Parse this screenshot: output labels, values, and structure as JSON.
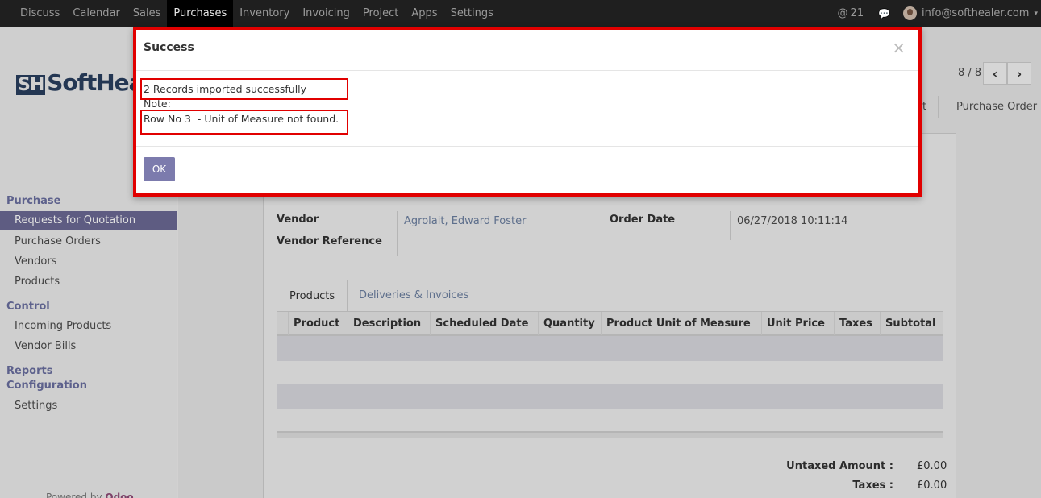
{
  "topbar": {
    "menu": [
      "Discuss",
      "Calendar",
      "Sales",
      "Purchases",
      "Inventory",
      "Invoicing",
      "Project",
      "Apps",
      "Settings"
    ],
    "active": "Purchases",
    "mentions": "21",
    "user": "info@softhealer.com"
  },
  "logo": {
    "mark": "SH",
    "text": "SoftHea"
  },
  "sidebar": {
    "purchase_title": "Purchase",
    "purchase_items": [
      "Requests for Quotation",
      "Purchase Orders",
      "Vendors",
      "Products"
    ],
    "control_title": "Control",
    "control_items": [
      "Incoming Products",
      "Vendor Bills"
    ],
    "reports_title": "Reports",
    "configuration_title": "Configuration",
    "configuration_items": [
      "Settings"
    ],
    "powered_prefix": "Powered by",
    "powered_brand": "Odoo"
  },
  "pager": {
    "text": "8 / 8",
    "prev": "‹",
    "next": "›"
  },
  "breadcrumb": {
    "partial": "t",
    "current": "Purchase Order"
  },
  "form": {
    "vendor_label": "Vendor",
    "vendor_value": "Agrolait, Edward Foster",
    "vendor_ref_label": "Vendor Reference",
    "order_date_label": "Order Date",
    "order_date_value": "06/27/2018 10:11:14"
  },
  "tabs": {
    "products": "Products",
    "deliveries": "Deliveries & Invoices"
  },
  "table": {
    "columns": [
      "Product",
      "Description",
      "Scheduled Date",
      "Quantity",
      "Product Unit of Measure",
      "Unit Price",
      "Taxes",
      "Subtotal"
    ]
  },
  "totals": {
    "untaxed_label": "Untaxed Amount :",
    "untaxed_value": "£0.00",
    "taxes_label": "Taxes :",
    "taxes_value": "£0.00"
  },
  "modal": {
    "title": "Success",
    "close": "×",
    "line1": "2 Records imported successfully",
    "line2": "Note:",
    "line3": "Row No 3  - Unit of Measure not found.",
    "ok": "OK"
  }
}
